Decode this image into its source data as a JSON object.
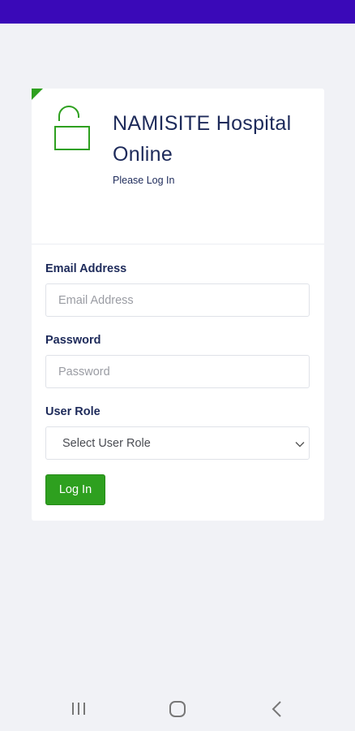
{
  "brand": {
    "title": "NAMISITE Hospital Online",
    "subtitle": "Please Log In"
  },
  "icons": {
    "lock": "unlocked-padlock-icon",
    "chevron": "chevron-down-icon",
    "nav_recent": "recent-apps-icon",
    "nav_home": "home-icon",
    "nav_back": "back-icon"
  },
  "form": {
    "email": {
      "label": "Email Address",
      "placeholder": "Email Address",
      "value": ""
    },
    "password": {
      "label": "Password",
      "placeholder": "Password",
      "value": ""
    },
    "role": {
      "label": "User Role",
      "selected": "Select User Role"
    },
    "submit_label": "Log In"
  },
  "colors": {
    "status_bar": "#3a09b8",
    "brand_text": "#1d2a5a",
    "accent_green": "#2ea01f",
    "page_background": "#f1f2f6"
  }
}
